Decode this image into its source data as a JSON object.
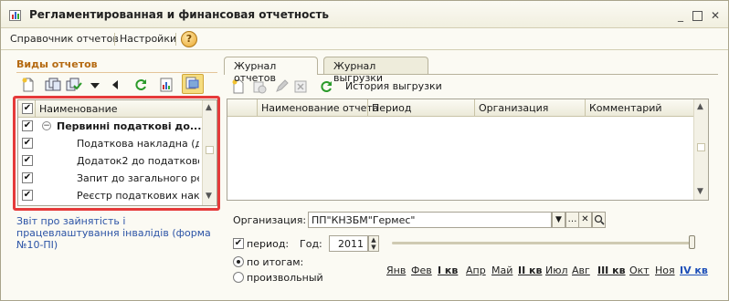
{
  "window": {
    "title": "Регламентированная и финансовая отчетность",
    "close_glyph": "✕",
    "maximize_glyph": "",
    "minimize_glyph": "_"
  },
  "menu": {
    "items": [
      "Справочник отчетов",
      "Настройки"
    ],
    "help_label": "?"
  },
  "left": {
    "section_title": "Виды отчетов",
    "tree_header": "Наименование",
    "rows": [
      {
        "label": "Первинні податкові до...",
        "bold": true,
        "group": true,
        "checked": true
      },
      {
        "label": "Податкова накладна (д...",
        "checked": true
      },
      {
        "label": "Додаток2 до податково...",
        "checked": true
      },
      {
        "label": "Запит до загального ре...",
        "checked": true
      },
      {
        "label": "Реєстр податкових нак...",
        "checked": true
      }
    ],
    "description": "Звіт про зайнятість і працевлаштування інвалідів (форма №10-ПІ)"
  },
  "tabs": [
    {
      "label": "Журнал отчетов",
      "active": true
    },
    {
      "label": "Журнал выгрузки",
      "active": false
    }
  ],
  "journal_toolbar": {
    "history_label": "История выгрузки"
  },
  "grid": {
    "columns": [
      "Наименование отчета",
      "Период",
      "Организация",
      "Комментарий"
    ]
  },
  "filters": {
    "org_label": "Организация:",
    "org_value": "ПП\"КНЗБМ\"Гермес\"",
    "period_label": "период:",
    "period_checked": true,
    "year_label": "Год:",
    "year_value": "2011",
    "radio_totals": "по итогам:",
    "radio_arbitrary": "произвольный",
    "selected_radio": "totals"
  },
  "months": [
    {
      "label": "Янв"
    },
    {
      "label": "Фев"
    },
    {
      "label": "I кв",
      "bold": true
    },
    {
      "label": "Апр"
    },
    {
      "label": "Май"
    },
    {
      "label": "II кв",
      "bold": true
    },
    {
      "label": "Июл"
    },
    {
      "label": "Авг"
    },
    {
      "label": "III кв",
      "bold": true
    },
    {
      "label": "Окт"
    },
    {
      "label": "Ноя"
    },
    {
      "label": "IV кв",
      "bold": true,
      "selected": true
    }
  ],
  "colors": {
    "accent": "#b56a12",
    "highlight": "#e53a3a",
    "link": "#2b53a6"
  }
}
